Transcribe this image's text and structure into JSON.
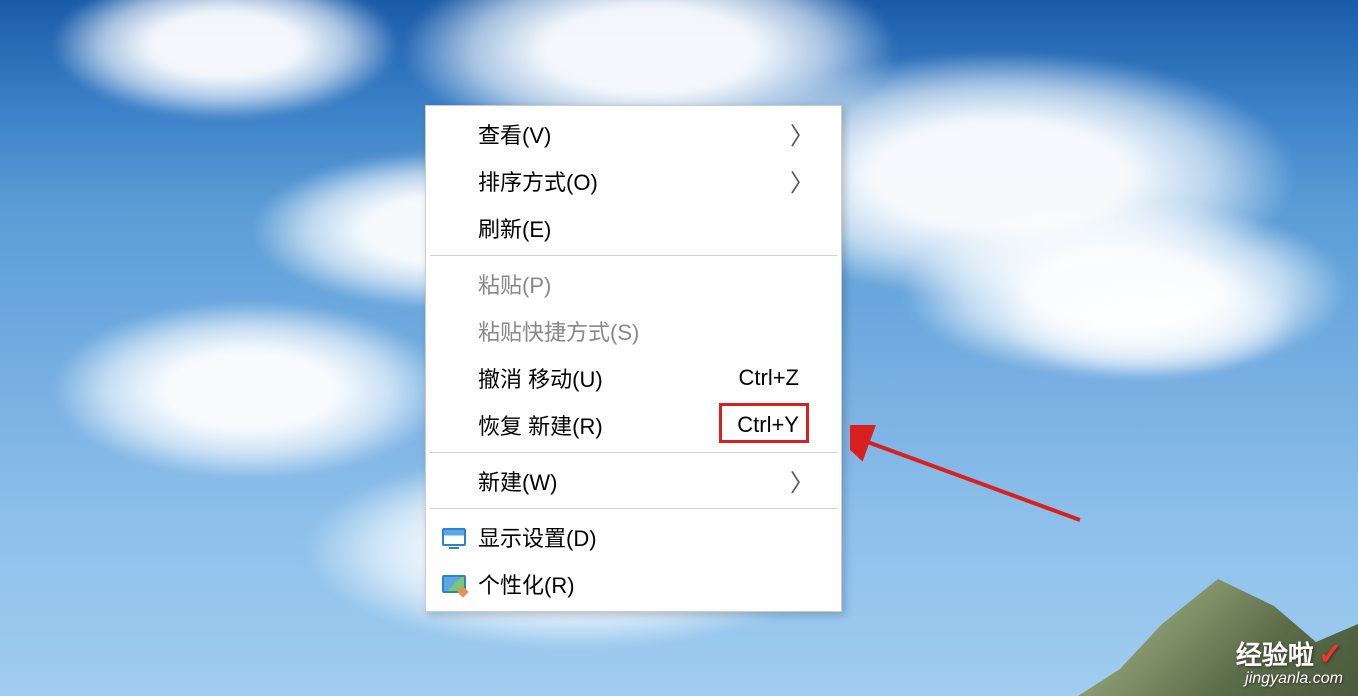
{
  "menu": {
    "view": {
      "label": "查看(V)",
      "has_submenu": true
    },
    "sort": {
      "label": "排序方式(O)",
      "has_submenu": true
    },
    "refresh": {
      "label": "刷新(E)"
    },
    "paste": {
      "label": "粘贴(P)",
      "disabled": true
    },
    "paste_shortcut": {
      "label": "粘贴快捷方式(S)",
      "disabled": true
    },
    "undo": {
      "label": "撤消 移动(U)",
      "shortcut": "Ctrl+Z"
    },
    "redo": {
      "label": "恢复 新建(R)",
      "shortcut": "Ctrl+Y"
    },
    "new": {
      "label": "新建(W)",
      "has_submenu": true
    },
    "display": {
      "label": "显示设置(D)"
    },
    "personalize": {
      "label": "个性化(R)"
    }
  },
  "watermark": {
    "title": "经验啦",
    "check": "✓",
    "url": "jingyanla.com"
  }
}
